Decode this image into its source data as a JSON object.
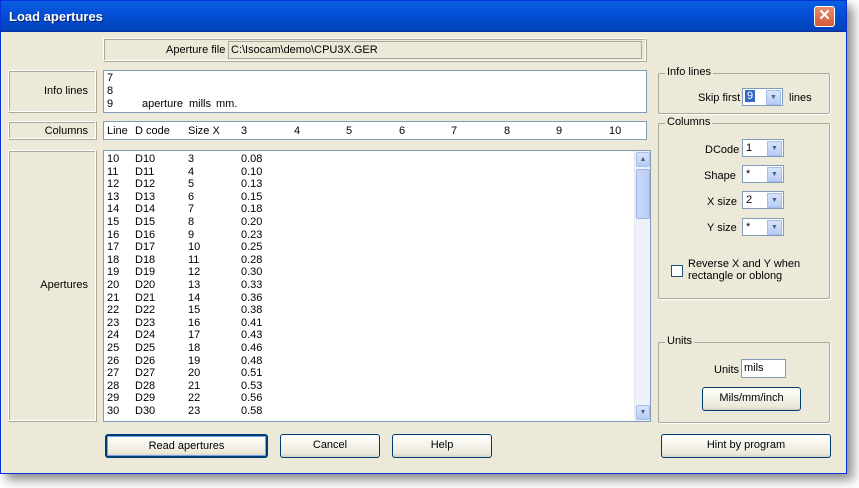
{
  "window": {
    "title": "Load apertures"
  },
  "aperture_file": {
    "label": "Aperture file",
    "value": "C:\\Isocam\\demo\\CPU3X.GER"
  },
  "info_lines": {
    "label": "Info lines",
    "lines": [
      "7",
      "8",
      "9       aperture   mills   mm."
    ]
  },
  "columns_header": {
    "label": "Columns",
    "line": "Line",
    "dcode": "D code",
    "sizex": "Size X",
    "nums": [
      "3",
      "4",
      "5",
      "6",
      "7",
      "8",
      "9",
      "10"
    ]
  },
  "apertures": {
    "label": "Apertures",
    "rows": [
      [
        "10",
        "D10",
        "3",
        "0.08"
      ],
      [
        "11",
        "D11",
        "4",
        "0.10"
      ],
      [
        "12",
        "D12",
        "5",
        "0.13"
      ],
      [
        "13",
        "D13",
        "6",
        "0.15"
      ],
      [
        "14",
        "D14",
        "7",
        "0.18"
      ],
      [
        "15",
        "D15",
        "8",
        "0.20"
      ],
      [
        "16",
        "D16",
        "9",
        "0.23"
      ],
      [
        "17",
        "D17",
        "10",
        "0.25"
      ],
      [
        "18",
        "D18",
        "11",
        "0.28"
      ],
      [
        "19",
        "D19",
        "12",
        "0.30"
      ],
      [
        "20",
        "D20",
        "13",
        "0.33"
      ],
      [
        "21",
        "D21",
        "14",
        "0.36"
      ],
      [
        "22",
        "D22",
        "15",
        "0.38"
      ],
      [
        "23",
        "D23",
        "16",
        "0.41"
      ],
      [
        "24",
        "D24",
        "17",
        "0.43"
      ],
      [
        "25",
        "D25",
        "18",
        "0.46"
      ],
      [
        "26",
        "D26",
        "19",
        "0.48"
      ],
      [
        "27",
        "D27",
        "20",
        "0.51"
      ],
      [
        "28",
        "D28",
        "21",
        "0.53"
      ],
      [
        "29",
        "D29",
        "22",
        "0.56"
      ],
      [
        "30",
        "D30",
        "23",
        "0.58"
      ]
    ]
  },
  "info_lines_group": {
    "title": "Info lines",
    "skip_first_label": "Skip first",
    "skip_first_value": "9",
    "lines_label": "lines"
  },
  "columns_group": {
    "title": "Columns",
    "dcode_label": "DCode",
    "dcode_value": "1",
    "shape_label": "Shape",
    "shape_value": "*",
    "xsize_label": "X size",
    "xsize_value": "2",
    "ysize_label": "Y size",
    "ysize_value": "*",
    "reverse_label_1": "Reverse X and Y when",
    "reverse_label_2": "rectangle or oblong",
    "reverse_checked": false
  },
  "units_group": {
    "title": "Units",
    "units_label": "Units",
    "units_value": "mils",
    "toggle_button": "Mils/mm/inch"
  },
  "buttons": {
    "read": "Read apertures",
    "cancel": "Cancel",
    "help": "Help",
    "hint": "Hint by program"
  }
}
